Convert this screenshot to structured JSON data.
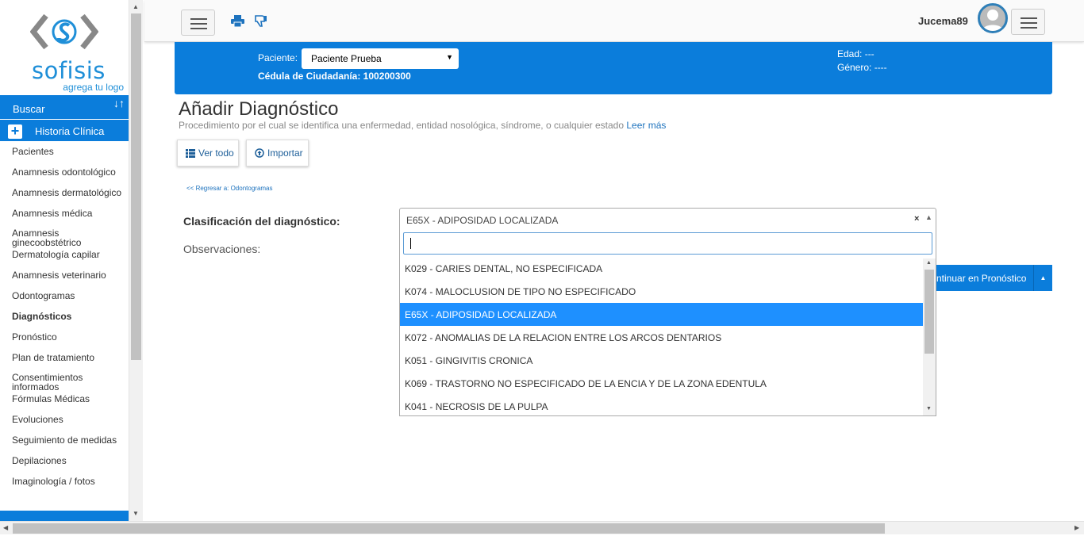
{
  "brand": {
    "name": "sofisis",
    "tagline": "agrega tu logo"
  },
  "sidebar": {
    "search_label": "Buscar",
    "section_label": "Historia Clínica",
    "items": [
      {
        "label": "Pacientes"
      },
      {
        "label": "Anamnesis odontológico"
      },
      {
        "label": "Anamnesis dermatológico"
      },
      {
        "label": "Anamnesis médica"
      },
      {
        "label": "Anamnesis ginecoobstétrico"
      },
      {
        "label": "Dermatología capilar"
      },
      {
        "label": "Anamnesis veterinario"
      },
      {
        "label": "Odontogramas"
      },
      {
        "label": "Diagnósticos"
      },
      {
        "label": "Pronóstico"
      },
      {
        "label": "Plan de tratamiento"
      },
      {
        "label": "Consentimientos informados"
      },
      {
        "label": "Fórmulas Médicas"
      },
      {
        "label": "Evoluciones"
      },
      {
        "label": "Seguimiento de medidas"
      },
      {
        "label": "Depilaciones"
      },
      {
        "label": "Imaginología / fotos"
      }
    ],
    "active_item": "Diagnósticos"
  },
  "header": {
    "username": "Jucema89"
  },
  "patient": {
    "label": "Paciente:",
    "selected": "Paciente Prueba",
    "cedula": "Cédula de Ciudadanía: 100200300",
    "edad": "Edad: ---",
    "genero": "Género: ----"
  },
  "main": {
    "title": "Añadir Diagnóstico",
    "description": "Procedimiento por el cual se identifica una enfermedad, entidad nosológica, síndrome, o cualquier estado",
    "read_more": "Leer más",
    "ver_todo": "Ver todo",
    "importar": "Importar",
    "back_link": "<< Regresar a: Odontogramas",
    "clasificacion_label": "Clasificación del diagnóstico:",
    "observaciones_label": "Observaciones:",
    "selected_value": "E65X - ADIPOSIDAD LOCALIZADA",
    "clear_symbol": "×",
    "search_value": "",
    "options": [
      {
        "label": "K029 - CARIES DENTAL, NO ESPECIFICADA"
      },
      {
        "label": "K074 - MALOCLUSION DE TIPO NO ESPECIFICADO"
      },
      {
        "label": "E65X - ADIPOSIDAD LOCALIZADA"
      },
      {
        "label": "K072 - ANOMALIAS DE LA RELACION ENTRE LOS ARCOS DENTARIOS"
      },
      {
        "label": "K051 - GINGIVITIS CRONICA"
      },
      {
        "label": "K069 - TRASTORNO NO ESPECIFICADO DE LA ENCIA Y DE LA ZONA EDENTULA"
      },
      {
        "label": "K041 - NECROSIS DE LA PULPA"
      }
    ],
    "highlighted_option": 2,
    "continue_label": "ntinuar en Pronóstico"
  },
  "colors": {
    "primary": "#0b7ddb",
    "highlight": "#1e90ff",
    "link": "#1e73be"
  },
  "icons": {
    "print": "print-icon",
    "dislike": "thumbs-down-icon",
    "menu": "hamburger-icon",
    "list": "list-icon",
    "import": "circle-up-icon",
    "avatar": "user-avatar-icon"
  }
}
